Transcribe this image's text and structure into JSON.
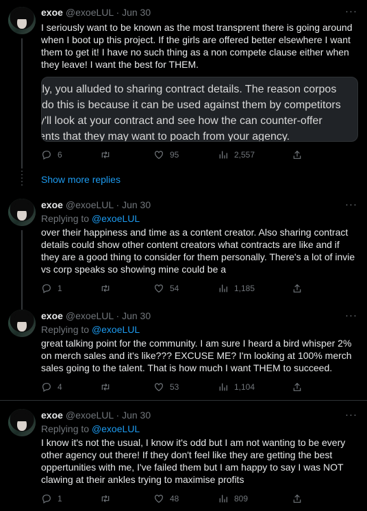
{
  "tweets": [
    {
      "name": "exoe",
      "meta": "@exoeLUL · Jun 30",
      "more": "···",
      "text": "I seriously want to be known as the most transprent there is going around when I boot up this project. If the girls are offered better elsewhere I want them to get it! I have no such thing as a non compete clause either when they leave! I want the best for THEM.",
      "quote_lines": [
        "tly, you alluded to sharing contract details. The reason corpos",
        " do this is because it can be used against them by competitors",
        "y'll look at your contract and see how the can counter-offer",
        "ents that they may want to poach from your agency."
      ],
      "replies": "6",
      "retweets": "",
      "likes": "95",
      "views": "2,557"
    },
    {
      "name": "exoe",
      "meta": "@exoeLUL · Jun 30",
      "more": "···",
      "replying_prefix": "Replying to ",
      "replying_handle": "@exoeLUL",
      "text": "over their happiness and time as a content creator. Also sharing contract details could show other content creators what contracts are like and if they are a good thing to consider for them personally. There's a lot of invie vs corp speaks so showing mine could be a",
      "replies": "1",
      "retweets": "",
      "likes": "54",
      "views": "1,185"
    },
    {
      "name": "exoe",
      "meta": "@exoeLUL · Jun 30",
      "more": "···",
      "replying_prefix": "Replying to ",
      "replying_handle": "@exoeLUL",
      "text": "great talking point for the community. I am sure I heard a bird whisper 2% on merch sales and it's like??? EXCUSE ME? I'm looking at 100% merch sales going to the talent. That is how much I want THEM to succeed.",
      "replies": "4",
      "retweets": "",
      "likes": "53",
      "views": "1,104"
    },
    {
      "name": "exoe",
      "meta": "@exoeLUL · Jun 30",
      "more": "···",
      "replying_prefix": "Replying to ",
      "replying_handle": "@exoeLUL",
      "text": "I know it's not the usual, I know it's odd but I am not wanting to be every other agency out there! If they don't feel like they are getting the best oppertunities with me, I've failed them but I am happy to say I was NOT clawing at their ankles trying to maximise profits",
      "replies": "1",
      "retweets": "",
      "likes": "48",
      "views": "809"
    }
  ],
  "show_more_replies": "Show more replies",
  "icons": [
    "reply-icon",
    "retweet-icon",
    "like-icon",
    "views-icon",
    "share-icon",
    "more-icon"
  ]
}
